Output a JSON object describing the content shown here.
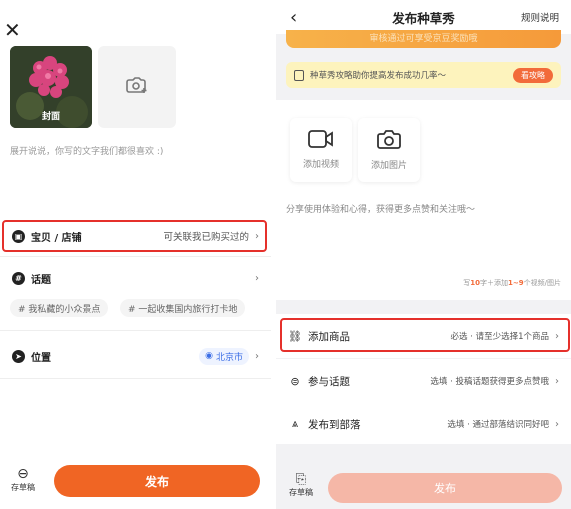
{
  "left": {
    "close_glyph": "✕",
    "cover_label": "封面",
    "text_placeholder": "展开说说，你写的文字我们都很喜欢 :)",
    "product_row": {
      "title": "宝贝 / 店铺",
      "hint": "可关联我已购买过的"
    },
    "topic_row": {
      "title": "话题"
    },
    "topic_chips": [
      "# 我私藏的小众景点",
      "# 一起收集国内旅行打卡地"
    ],
    "location_row": {
      "title": "位置",
      "value": "北京市"
    },
    "draft_label": "存草稿",
    "publish_label": "发布"
  },
  "right": {
    "nav": {
      "back_glyph": "‹",
      "title": "发布种草秀",
      "rule": "规则说明"
    },
    "banner_text": "审核通过可享受京豆奖励哦",
    "tip": {
      "text": "种草秀攻略助你提高发布成功几率～",
      "button": "看攻略"
    },
    "upload_video": "添加视频",
    "upload_image": "添加图片",
    "text_hint": "分享使用体验和心得，获得更多点赞和关注哦～",
    "counter": {
      "prefix": "写",
      "chars": "10",
      "mid": "字＋添加",
      "range": "1~9",
      "suffix": "个视频/图片"
    },
    "rows": [
      {
        "label": "添加商品",
        "hint": "必选 · 请至少选择1个商品"
      },
      {
        "label": "参与话题",
        "hint": "选填 · 投稿话题获得更多点赞哦"
      },
      {
        "label": "发布到部落",
        "hint": "选填 · 通过部落结识同好吧"
      }
    ],
    "draft_label": "存草稿",
    "publish_label": "发布"
  },
  "colors": {
    "accent": "#f06524",
    "highlight_box": "#e5302b",
    "location": "#3b6ee6"
  },
  "icons": [
    "close-icon",
    "camera-plus-icon",
    "shop-icon",
    "hash-icon",
    "location-icon",
    "chevron-right-icon",
    "draft-icon",
    "video-icon",
    "camera-icon",
    "link-icon",
    "topic-icon",
    "tribe-icon",
    "book-icon"
  ]
}
